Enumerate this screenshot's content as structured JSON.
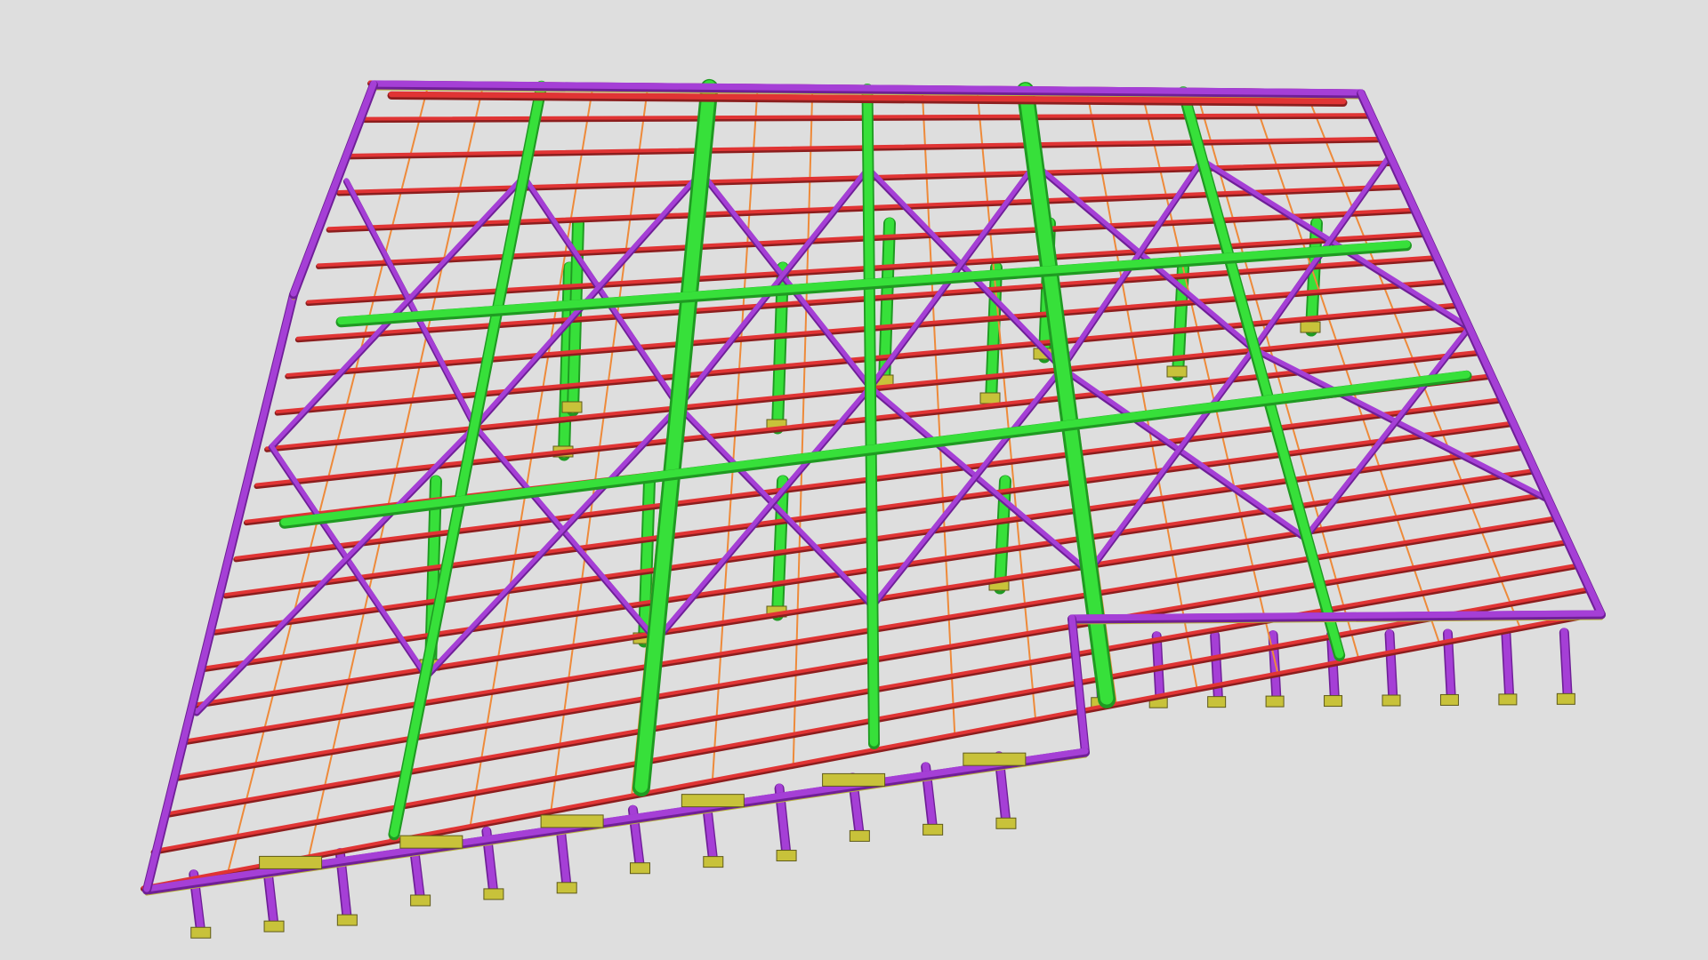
{
  "viewer": {
    "background": "#dedede"
  },
  "model": {
    "description_colors": {
      "column_green": "#37e03a",
      "column_green_dark": "#1f9a22",
      "edge_purple": "#a53fd6",
      "edge_purple_dark": "#6f1f97",
      "purlin_red": "#e03434",
      "sagrod_orange": "#ee8a3a",
      "brace_olive": "#b9b23c",
      "baseplate_yellow": "#c8c23a",
      "baseplate_dark": "#5f5a1a"
    }
  }
}
